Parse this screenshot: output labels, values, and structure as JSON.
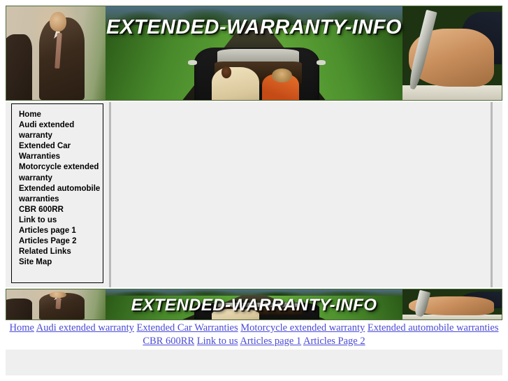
{
  "site": {
    "title": "EXTENDED-WARRANTY-INFO",
    "header_title": "EXTENDED-WARRANTY-INFO",
    "footer_title": "EXTENDED-WARRANTY-INFO"
  },
  "colors": {
    "page_background": "#ffffff",
    "content_background": "#efefef",
    "banner_border": "#4d6b3a",
    "sidebar_border": "#000000",
    "divider": "#b9b9b9",
    "link": "#4a4ad6",
    "nav_text": "#000000",
    "banner_title": "#ffffff"
  },
  "sidebar": {
    "items": [
      {
        "label": "Home"
      },
      {
        "label": "Audi extended warranty"
      },
      {
        "label": "Extended Car Warranties"
      },
      {
        "label": "Motorcycle extended warranty"
      },
      {
        "label": "Extended automobile warranties"
      },
      {
        "label": "CBR 600RR"
      },
      {
        "label": "Link to us"
      },
      {
        "label": "Articles page 1"
      },
      {
        "label": "Articles Page 2"
      },
      {
        "label": "Related Links"
      },
      {
        "label": "Site Map"
      }
    ]
  },
  "footer": {
    "links": [
      {
        "label": "Home"
      },
      {
        "label": "Audi extended warranty"
      },
      {
        "label": "Extended Car Warranties"
      },
      {
        "label": "Motorcycle extended warranty"
      },
      {
        "label": "Extended automobile warranties"
      },
      {
        "label": "CBR 600RR"
      },
      {
        "label": "Link to us"
      },
      {
        "label": "Articles page 1"
      },
      {
        "label": "Articles Page 2"
      }
    ]
  },
  "main": {
    "content_text": ""
  }
}
